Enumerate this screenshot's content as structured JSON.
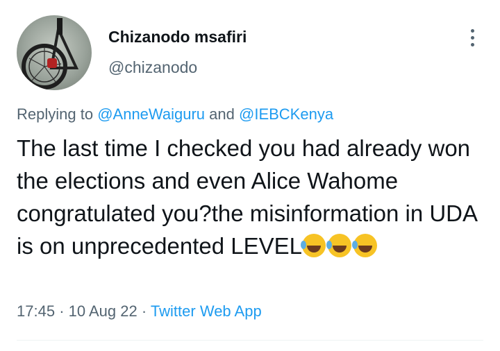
{
  "author": {
    "display_name": "Chizanodo msafiri",
    "handle": "@chizanodo"
  },
  "reply": {
    "prefix": "Replying to",
    "mention_1": "@AnneWaiguru",
    "conjunction": "and",
    "mention_2": "@IEBCKenya"
  },
  "tweet": {
    "text": "The last time I checked you had already won the elections and even Alice Wahome congratulated you?the misinformation in UDA is on unprecedented LEVEL",
    "emojis": [
      "rolling-on-floor-laughing-emoji",
      "rolling-on-floor-laughing-emoji",
      "rolling-on-floor-laughing-emoji"
    ]
  },
  "meta": {
    "time": "17:45",
    "sep": "·",
    "date": "10 Aug 22",
    "source": "Twitter Web App"
  },
  "colors": {
    "link": "#1d9bf0",
    "secondary_text": "#536471",
    "primary_text": "#0f1419"
  }
}
